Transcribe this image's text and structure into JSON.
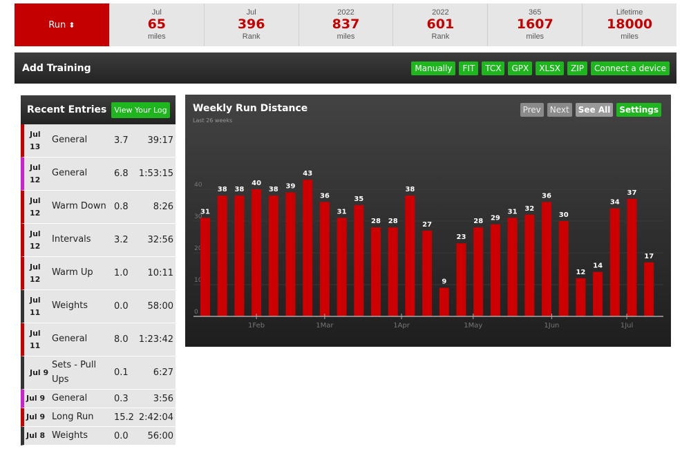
{
  "stats": {
    "run_label": "Run",
    "run_arrow": "⬍",
    "items": [
      {
        "period": "Jul",
        "value": "65",
        "unit": "miles"
      },
      {
        "period": "Jul",
        "value": "396",
        "unit": "Rank"
      },
      {
        "period": "2022",
        "value": "837",
        "unit": "miles"
      },
      {
        "period": "2022",
        "value": "601",
        "unit": "Rank"
      },
      {
        "period": "365",
        "value": "1607",
        "unit": "miles"
      },
      {
        "period": "Lifetime",
        "value": "18000",
        "unit": "miles"
      }
    ]
  },
  "add_training": {
    "title": "Add Training",
    "buttons": [
      "Manually",
      "FIT",
      "TCX",
      "GPX",
      "XLSX",
      "ZIP",
      "Connect a device"
    ]
  },
  "recent": {
    "title": "Recent Entries",
    "view_log": "View Your Log",
    "entries": [
      {
        "date": "Jul 13",
        "name": "General",
        "dist": "3.7",
        "time": "39:17",
        "color": "#c40000"
      },
      {
        "date": "Jul 12",
        "name": "General",
        "dist": "6.8",
        "time": "1:53:15",
        "color": "#cc22cc"
      },
      {
        "date": "Jul 12",
        "name": "Warm Down",
        "dist": "0.8",
        "time": "8:26",
        "color": "#c40000"
      },
      {
        "date": "Jul 12",
        "name": "Intervals",
        "dist": "3.2",
        "time": "32:56",
        "color": "#c40000"
      },
      {
        "date": "Jul 12",
        "name": "Warm Up",
        "dist": "1.0",
        "time": "10:11",
        "color": "#c40000"
      },
      {
        "date": "Jul 11",
        "name": "Weights",
        "dist": "0.0",
        "time": "58:00",
        "color": "#333333"
      },
      {
        "date": "Jul 11",
        "name": "General",
        "dist": "8.0",
        "time": "1:23:42",
        "color": "#c40000"
      },
      {
        "date": "Jul 9",
        "name": "Sets - Pull Ups",
        "dist": "0.1",
        "time": "6:27",
        "color": "#333333"
      },
      {
        "date": "Jul 9",
        "name": "General",
        "dist": "0.3",
        "time": "3:56",
        "color": "#cc22cc"
      },
      {
        "date": "Jul 9",
        "name": "Long Run",
        "dist": "15.2",
        "time": "2:42:04",
        "color": "#c40000"
      },
      {
        "date": "Jul 8",
        "name": "Weights",
        "dist": "0.0",
        "time": "56:00",
        "color": "#333333"
      }
    ]
  },
  "chart_panel": {
    "buttons": {
      "prev": "Prev",
      "next": "Next",
      "see_all": "See All",
      "settings": "Settings"
    }
  },
  "chart_data": {
    "type": "bar",
    "title": "Weekly Run Distance",
    "subtitle": "Last 26 weeks",
    "xlabel": "",
    "ylabel": "",
    "values": [
      31,
      38,
      38,
      40,
      38,
      39,
      43,
      36,
      31,
      35,
      28,
      28,
      38,
      27,
      9,
      23,
      28,
      29,
      31,
      32,
      36,
      30,
      12,
      14,
      34,
      37,
      17
    ],
    "ylim": [
      0,
      50
    ],
    "y_ticks": [
      "0",
      "10",
      "20",
      "30",
      "40",
      "50"
    ],
    "x_ticks": [
      {
        "label": "1Feb",
        "at_bar": 3
      },
      {
        "label": "1Mar",
        "at_bar": 7
      },
      {
        "label": "1Apr",
        "at_bar": 11.5
      },
      {
        "label": "1May",
        "at_bar": 15.7
      },
      {
        "label": "1Jun",
        "at_bar": 20.3
      },
      {
        "label": "1Jul",
        "at_bar": 24.7
      }
    ],
    "bar_color": "#cc0000",
    "data_labels": true,
    "grid": true
  }
}
